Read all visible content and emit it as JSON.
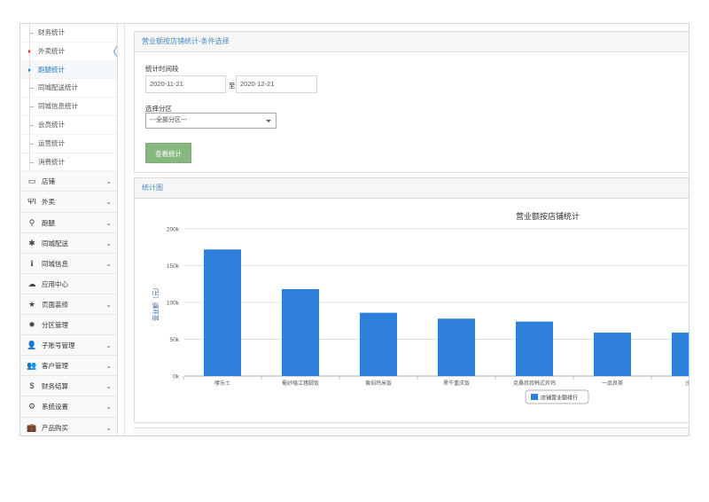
{
  "sidebar": {
    "sub_items": [
      {
        "label": "财务统计",
        "state": "normal"
      },
      {
        "label": "外卖统计",
        "state": "red"
      },
      {
        "label": "跑腿统计",
        "state": "active"
      },
      {
        "label": "同城配送统计",
        "state": "normal"
      },
      {
        "label": "同城信息统计",
        "state": "normal"
      },
      {
        "label": "会员统计",
        "state": "normal"
      },
      {
        "label": "运营统计",
        "state": "normal"
      },
      {
        "label": "消费统计",
        "state": "normal"
      }
    ],
    "nav_items": [
      {
        "label": "店铺",
        "icon": "desktop-icon",
        "glyph": "▭",
        "has_chevron": true
      },
      {
        "label": "外卖",
        "icon": "cutlery-icon",
        "glyph": "ΨΙ",
        "has_chevron": true
      },
      {
        "label": "跑腿",
        "icon": "bicycle-icon",
        "glyph": "⚲",
        "has_chevron": true
      },
      {
        "label": "同城配送",
        "icon": "asterisk-icon",
        "glyph": "✱",
        "has_chevron": true
      },
      {
        "label": "同城信息",
        "icon": "info-icon",
        "glyph": "ℹ",
        "has_chevron": true
      },
      {
        "label": "应用中心",
        "icon": "cloud-icon",
        "glyph": "☁",
        "has_chevron": false
      },
      {
        "label": "页面装修",
        "icon": "star-icon",
        "glyph": "★",
        "has_chevron": true
      },
      {
        "label": "分区管理",
        "icon": "cog-icon",
        "glyph": "✹",
        "has_chevron": false
      },
      {
        "label": "子账号管理",
        "icon": "user-icon",
        "glyph": "👤",
        "has_chevron": true
      },
      {
        "label": "客户管理",
        "icon": "users-icon",
        "glyph": "👥",
        "has_chevron": true
      },
      {
        "label": "财务结算",
        "icon": "dollar-icon",
        "glyph": "$",
        "has_chevron": true
      },
      {
        "label": "系统设置",
        "icon": "gear-icon",
        "glyph": "⚙",
        "has_chevron": true
      },
      {
        "label": "产品购买",
        "icon": "briefcase-icon",
        "glyph": "💼",
        "has_chevron": true
      }
    ],
    "chevron_glyph": "⌄"
  },
  "conditions": {
    "title": "营业额按店铺统计-条件选择",
    "period_label": "统计时间段",
    "start_date": "2020-11-21",
    "to_label": "至",
    "end_date": "2020-12-21",
    "zone_label": "选择分区",
    "zone_selected": "---全部分区---",
    "query_button": "查看统计"
  },
  "chart_panel": {
    "title": "统计图"
  },
  "colors": {
    "accent_blue": "#2b7dbc",
    "bar_blue": "#2d7fd9",
    "button_green": "#87b87f"
  },
  "chart_data": {
    "type": "bar",
    "title": "营业额按店铺统计",
    "ylabel": "营业额（元）",
    "xlabel": "",
    "categories": [
      "嗲乐士",
      "蜀好嗑江猪脚饭",
      "黄焖鸡米饭",
      "黑牛重庆饭",
      "克桑叔叔韩式炸鸡",
      "一品良茶",
      "沙县"
    ],
    "series": [
      {
        "name": "店铺营业额排行",
        "values": [
          172000,
          118000,
          86000,
          78000,
          74000,
          59000,
          59000
        ]
      }
    ],
    "y_ticks": [
      "0k",
      "50k",
      "100k",
      "150k",
      "200k"
    ],
    "ylim": [
      0,
      200000
    ],
    "grid": true,
    "legend_position": "bottom"
  }
}
